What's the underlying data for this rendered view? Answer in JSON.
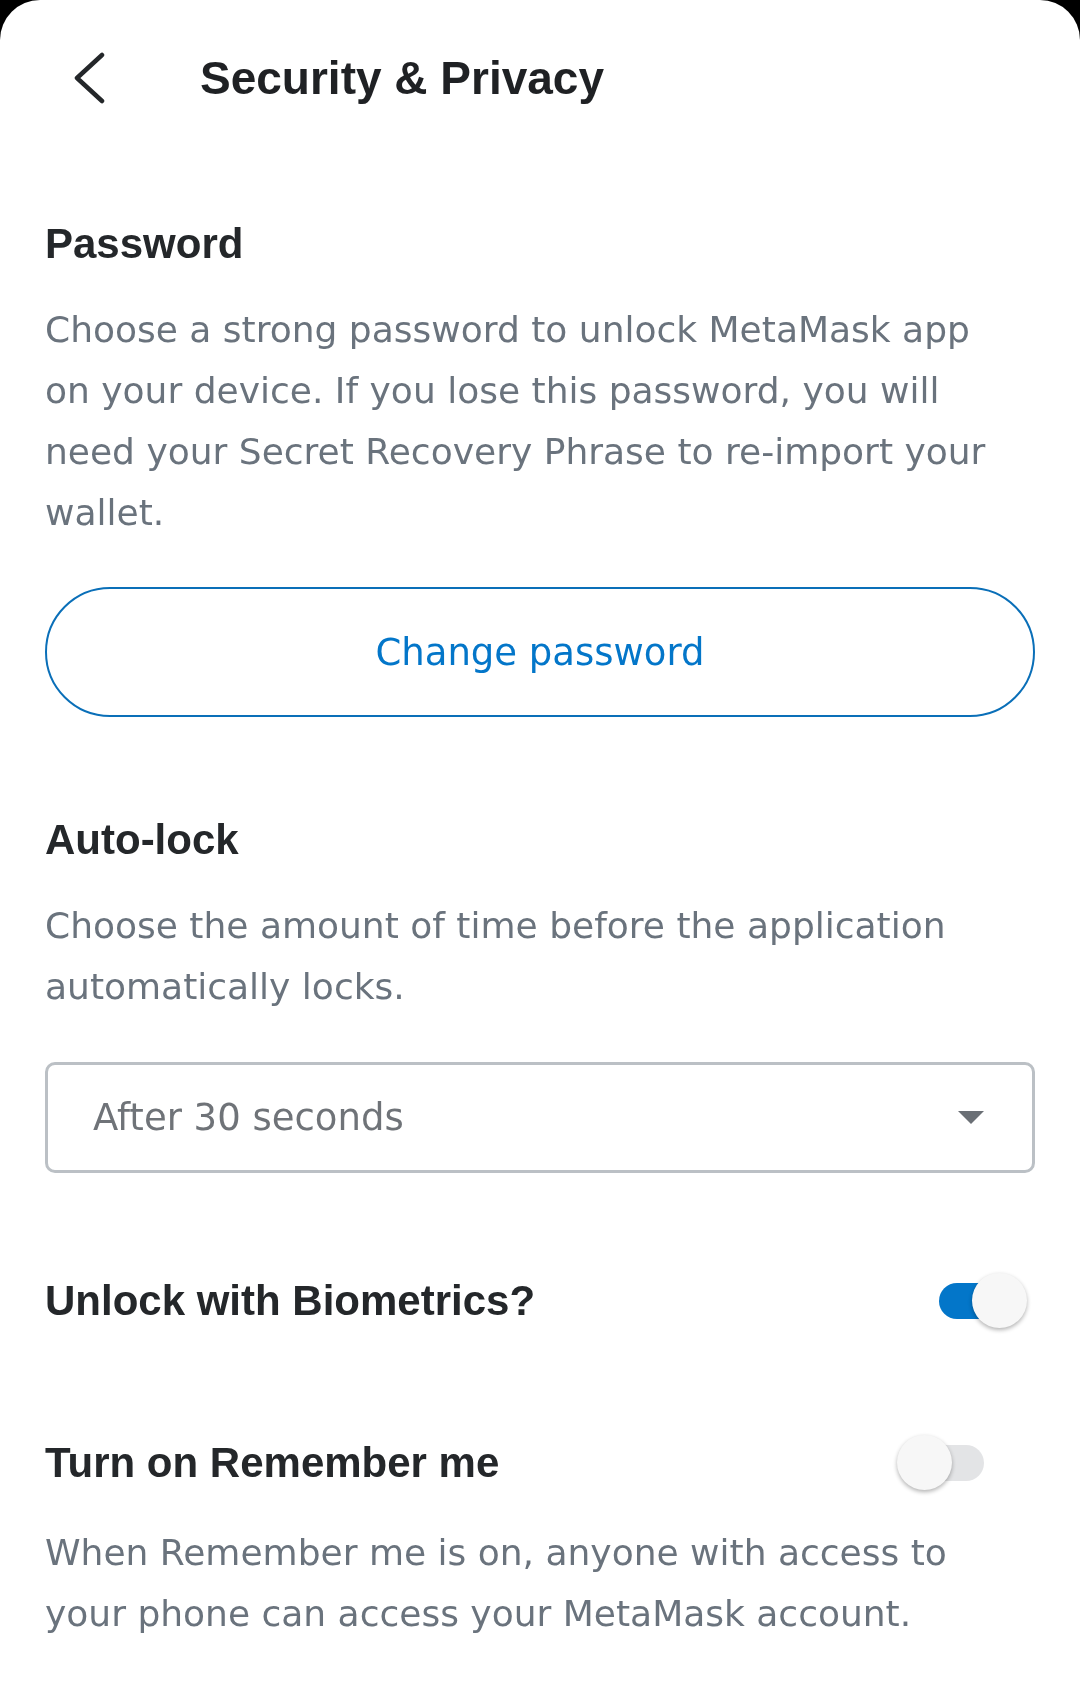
{
  "header": {
    "title": "Security & Privacy"
  },
  "password": {
    "heading": "Password",
    "description": "Choose a strong password to unlock MetaMask app on your device. If you lose this password, you will need your Secret Recovery Phrase to re-import your wallet.",
    "button": "Change password"
  },
  "auto_lock": {
    "heading": "Auto-lock",
    "description": "Choose the amount of time before the application automatically locks.",
    "value": "After 30 seconds"
  },
  "toggles": [
    {
      "label": "Unlock with Biometrics?",
      "on": true
    },
    {
      "label": "Turn on Remember me",
      "on": false,
      "description": "When Remember me is on, anyone with access to your phone can access your MetaMask account."
    }
  ]
}
